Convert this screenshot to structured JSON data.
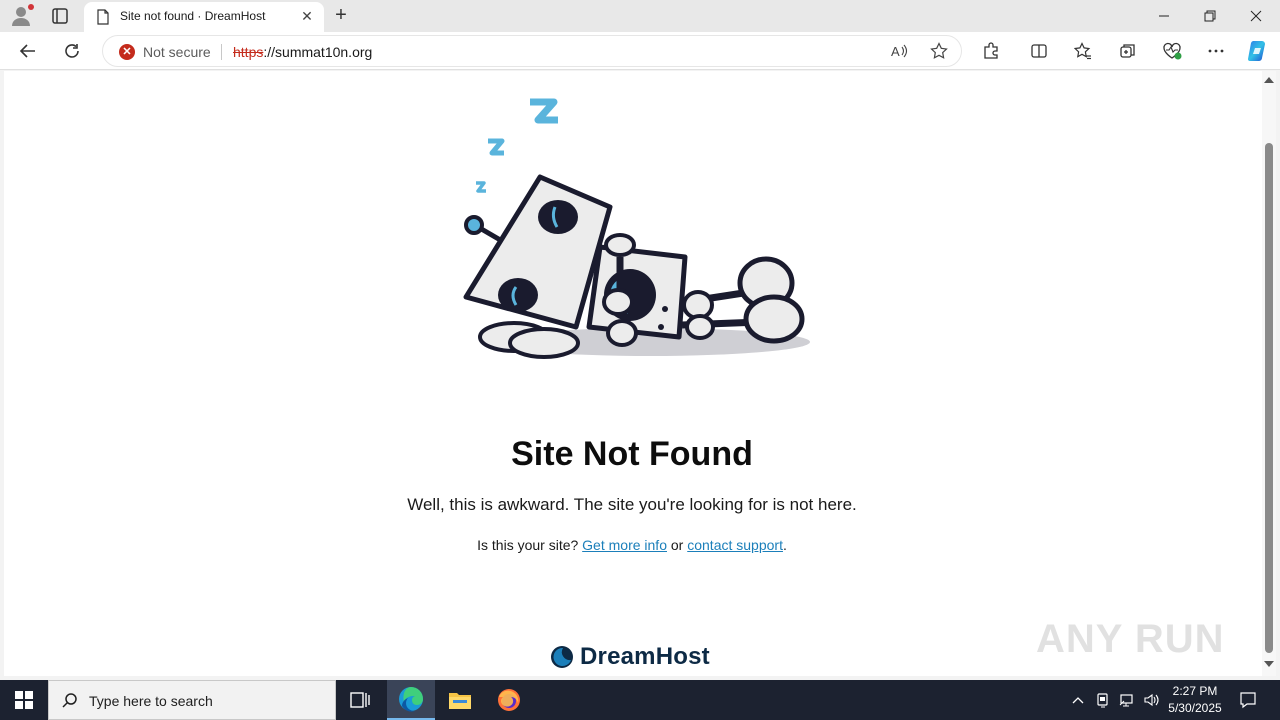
{
  "browser": {
    "tab": {
      "title": "Site not found · DreamHost"
    },
    "address": {
      "security_label": "Not secure",
      "url_scheme": "https",
      "url_rest": "://summat10n.org"
    },
    "icons": {
      "profile": "profile-icon",
      "tab_actions": "tab-actions-icon",
      "new_tab": "plus-icon",
      "back": "back-arrow-icon",
      "refresh": "refresh-icon",
      "read_aloud": "read-aloud-icon",
      "favorite": "star-icon",
      "extensions": "puzzle-icon",
      "split": "split-screen-icon",
      "favorites": "favorites-icon",
      "collections": "collections-icon",
      "browser_essentials": "heart-pulse-icon",
      "more": "ellipsis-icon",
      "copilot": "copilot-icon"
    }
  },
  "page": {
    "title": "Site Not Found",
    "lead": "Well, this is awkward. The site you're looking for is not here.",
    "sub_prefix": "Is this your site?",
    "link_more_info": "Get more info",
    "sub_or": "or",
    "link_contact": "contact support",
    "sub_suffix": ".",
    "brand": "DreamHost"
  },
  "watermark": {
    "text": "ANY RUN"
  },
  "taskbar": {
    "search_placeholder": "Type here to search",
    "time": "2:27 PM",
    "date": "5/30/2025"
  },
  "colors": {
    "link": "#1b7fba",
    "insecure": "#c42b1c",
    "robot_blue": "#5ab4dc",
    "taskbar_bg": "#1c2230"
  }
}
